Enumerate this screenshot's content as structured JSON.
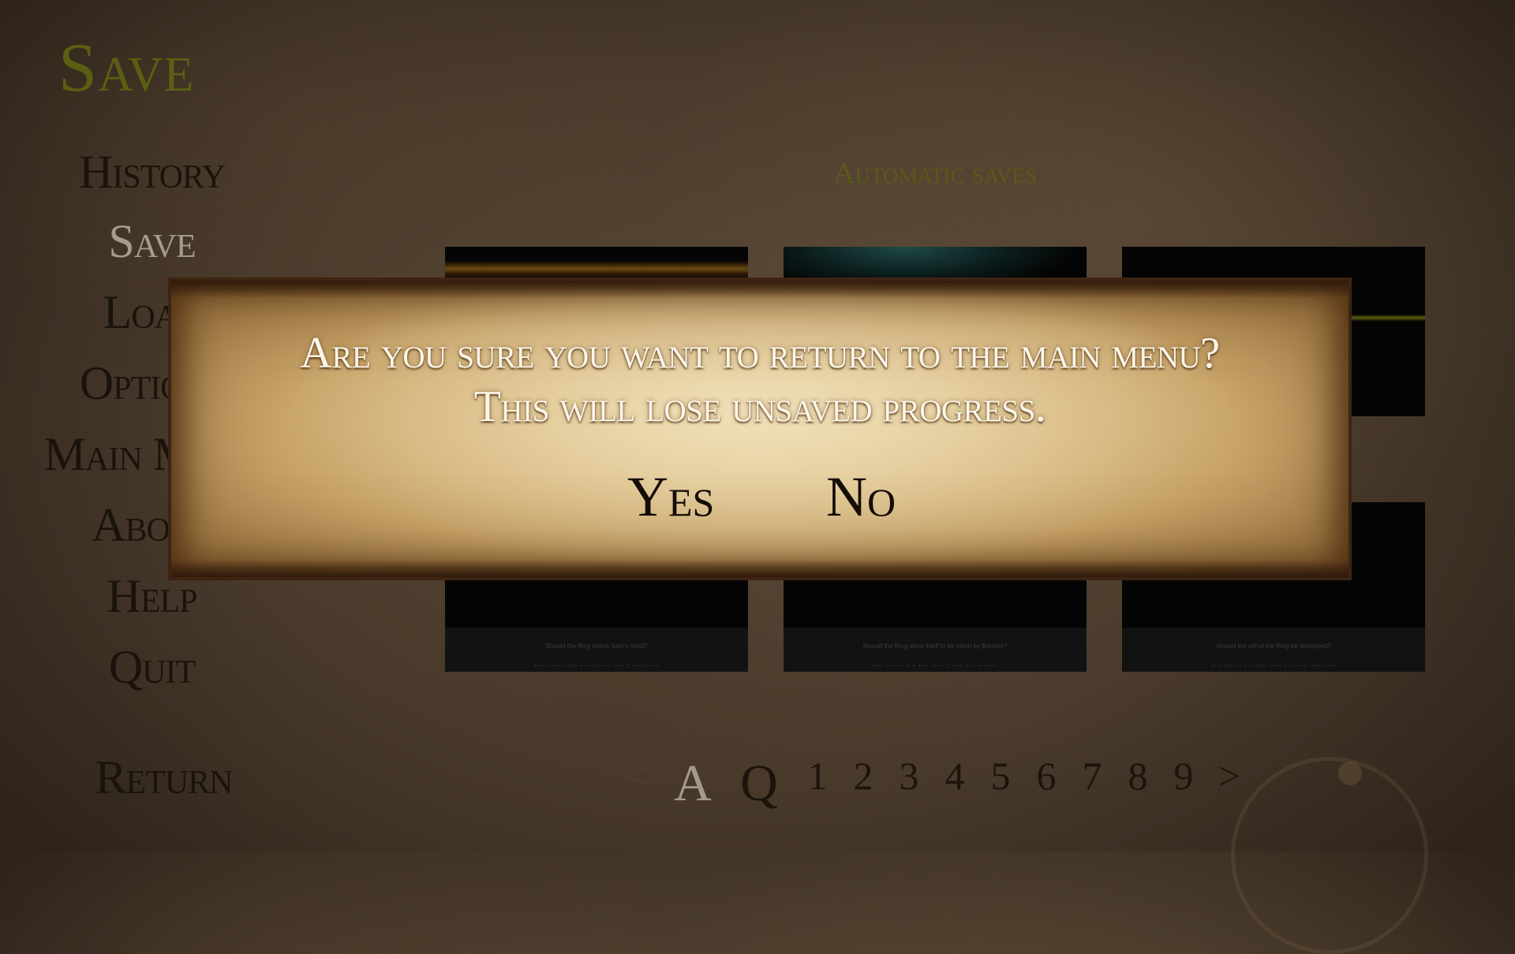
{
  "screen_title": "Save",
  "nav": {
    "items": [
      {
        "label": "History"
      },
      {
        "label": "Save",
        "active": true
      },
      {
        "label": "Load"
      },
      {
        "label": "Options"
      },
      {
        "label": "Main Menu"
      },
      {
        "label": "About"
      },
      {
        "label": "Help"
      },
      {
        "label": "Quit"
      }
    ],
    "return_label": "Return"
  },
  "section_heading": "Automatic saves",
  "slots": [
    {
      "caption": "",
      "quick_menu": ""
    },
    {
      "caption": "",
      "quick_menu": ""
    },
    {
      "caption": "",
      "quick_menu": ""
    },
    {
      "caption": "Should the Ring entice Sam's mind?",
      "quick_menu": "Back  History  Skip  Auto  Save  Q.Save  Q.Load  Prefs"
    },
    {
      "caption": "Should the Ring allow itself to be taken by Boromir?",
      "quick_menu": "Back  History  Skip  Auto  Save  Q.Save  Q.Load  Prefs"
    },
    {
      "caption": "Should the will of the Ring be destroyed?",
      "quick_menu": "Back  History  Skip  Auto  Save  Q.Save  Q.Load  Prefs"
    }
  ],
  "pagination": {
    "prev": "<",
    "auto": "A",
    "quick": "Q",
    "pages": [
      "1",
      "2",
      "3",
      "4",
      "5",
      "6",
      "7",
      "8",
      "9"
    ],
    "next": ">"
  },
  "dialog": {
    "line1": "Are you sure you want to return to the main menu?",
    "line2": "This will lose unsaved progress.",
    "yes_label": "Yes",
    "no_label": "No"
  },
  "colors": {
    "title": "#5a5f12",
    "nav_text": "#1a130c",
    "nav_active": "#a59c8e",
    "heading": "#5b5a18",
    "dialog_text": "#fbf6ea",
    "dialog_choice": "#140d06"
  }
}
